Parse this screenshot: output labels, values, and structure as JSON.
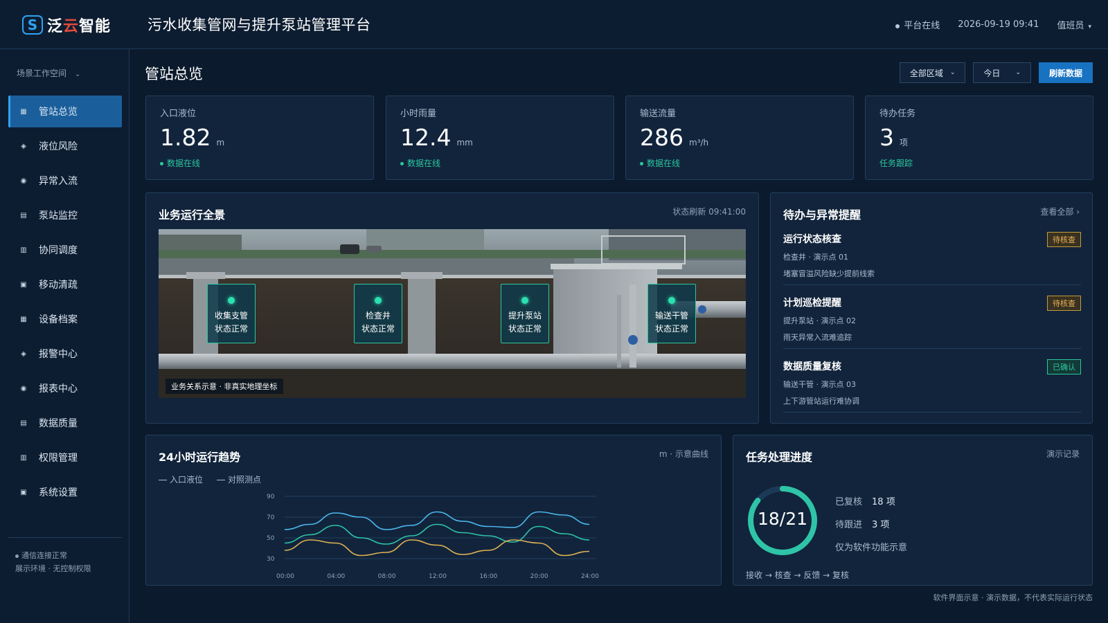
{
  "brand": {
    "logo_mark": "S",
    "logo_text_a": "泛",
    "logo_text_b": "云",
    "logo_text_c": "智能"
  },
  "header": {
    "title": "污水收集管网与提升泵站管理平台",
    "status": "平台在线",
    "datetime": "2026-09-19 09:41",
    "user": "值班员"
  },
  "sidebar": {
    "workspace": "场景工作空间",
    "items": [
      {
        "label": "管站总览",
        "icon": "grid-icon"
      },
      {
        "label": "液位风险",
        "icon": "diamond-icon"
      },
      {
        "label": "异常入流",
        "icon": "circle-icon"
      },
      {
        "label": "泵站监控",
        "icon": "list-icon"
      },
      {
        "label": "协同调度",
        "icon": "table-icon"
      },
      {
        "label": "移动清疏",
        "icon": "square-icon"
      },
      {
        "label": "设备档案",
        "icon": "grid-icon"
      },
      {
        "label": "报警中心",
        "icon": "diamond-icon"
      },
      {
        "label": "报表中心",
        "icon": "circle-icon"
      },
      {
        "label": "数据质量",
        "icon": "list-icon"
      },
      {
        "label": "权限管理",
        "icon": "table-icon"
      },
      {
        "label": "系统设置",
        "icon": "square-icon"
      }
    ],
    "foot_status": "通信连接正常",
    "foot_env": "展示环境 · 无控制权限"
  },
  "main": {
    "title": "管站总览",
    "filters": {
      "region": "全部区域",
      "period": "今日",
      "refresh": "刷新数据"
    }
  },
  "kpis": [
    {
      "label": "入口液位",
      "value": "1.82",
      "unit": "m",
      "status": "数据在线"
    },
    {
      "label": "小时雨量",
      "value": "12.4",
      "unit": "mm",
      "status": "数据在线"
    },
    {
      "label": "输送流量",
      "value": "286",
      "unit": "m³/h",
      "status": "数据在线"
    },
    {
      "label": "待办任务",
      "value": "3",
      "unit": "项",
      "status": "任务跟踪"
    }
  ],
  "overview": {
    "title": "业务运行全景",
    "refresh": "状态刷新 09:41:00",
    "caption": "业务关系示意 · 非真实地理坐标",
    "nodes": [
      {
        "name": "收集支管",
        "state": "状态正常"
      },
      {
        "name": "检查井",
        "state": "状态正常"
      },
      {
        "name": "提升泵站",
        "state": "状态正常"
      },
      {
        "name": "输送干管",
        "state": "状态正常"
      }
    ]
  },
  "alerts": {
    "title": "待办与异常提醒",
    "view_all": "查看全部 ›",
    "items": [
      {
        "title": "运行状态核查",
        "sub": "检查井 · 演示点 01",
        "desc": "堵塞冒溢风险缺少提前线索",
        "badge": "待核查",
        "badge_type": "pending"
      },
      {
        "title": "计划巡检提醒",
        "sub": "提升泵站 · 演示点 02",
        "desc": "雨天异常入流难追踪",
        "badge": "待核查",
        "badge_type": "pending"
      },
      {
        "title": "数据质量复核",
        "sub": "输送干管 · 演示点 03",
        "desc": "上下游管站运行难协调",
        "badge": "已确认",
        "badge_type": "ok"
      }
    ]
  },
  "trend": {
    "title": "24小时运行趋势",
    "meta": "m · 示意曲线"
  },
  "chart_data": {
    "type": "line",
    "x": [
      "00:00",
      "02:00",
      "04:00",
      "06:00",
      "08:00",
      "10:00",
      "12:00",
      "14:00",
      "16:00",
      "18:00",
      "20:00",
      "22:00",
      "24:00"
    ],
    "x_ticks": [
      "00:00",
      "04:00",
      "08:00",
      "12:00",
      "16:00",
      "20:00",
      "24:00"
    ],
    "ylim": [
      30,
      90
    ],
    "y_ticks": [
      90,
      70,
      50,
      30
    ],
    "series": [
      {
        "name": "入口液位",
        "color": "#4cb8ef",
        "values": [
          58,
          63,
          74,
          70,
          58,
          62,
          75,
          66,
          61,
          60,
          75,
          72,
          63
        ]
      },
      {
        "name": "对照测点",
        "color": "#2fc4a7",
        "values": [
          45,
          53,
          62,
          50,
          44,
          52,
          63,
          55,
          52,
          46,
          61,
          54,
          48
        ]
      },
      {
        "name": "",
        "color": "#e0b255",
        "values": [
          38,
          48,
          45,
          33,
          36,
          48,
          43,
          34,
          38,
          48,
          45,
          33,
          37
        ]
      }
    ]
  },
  "progress": {
    "title": "任务处理进度",
    "meta": "演示记录",
    "ring_text": "18/21",
    "done": 18,
    "total": 21,
    "ring_color": "#2fc4a7",
    "rows": [
      {
        "label": "已复核",
        "value": "18 项"
      },
      {
        "label": "待跟进",
        "value": "3 项"
      }
    ],
    "note": "仅为软件功能示意",
    "flow": "接收 → 核查 → 反馈 → 复核"
  },
  "footer": "软件界面示意 · 演示数据，不代表实际运行状态"
}
